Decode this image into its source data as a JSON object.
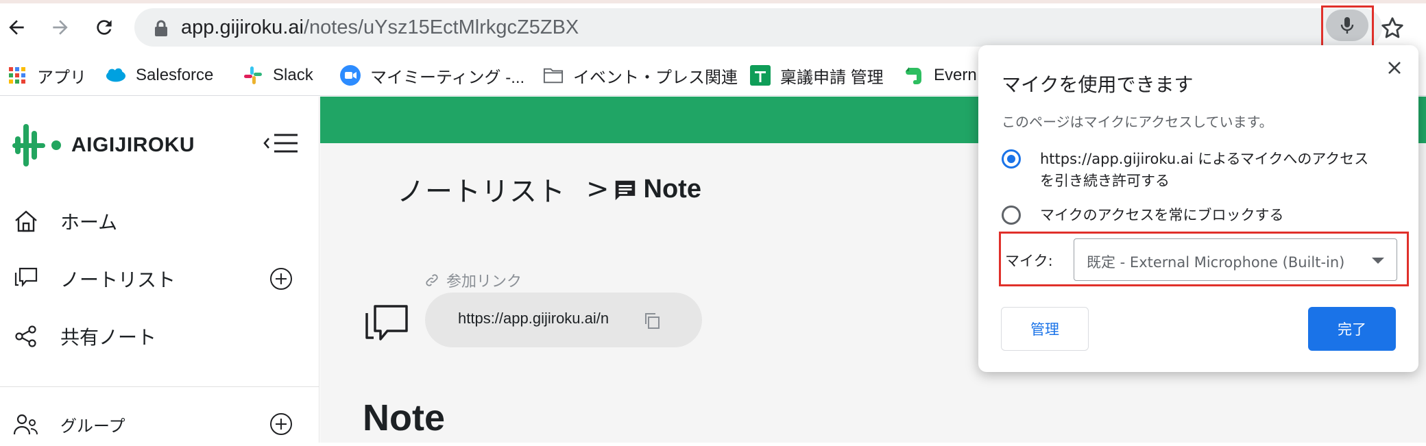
{
  "browser": {
    "url_host": "app.gijiroku.ai",
    "url_path": "/notes/uYsz15EctMlrkgcZ5ZBX"
  },
  "bookmarks": [
    {
      "label": "アプリ",
      "icon": "apps-grid-icon"
    },
    {
      "label": "Salesforce",
      "icon": "salesforce-cloud-icon"
    },
    {
      "label": "Slack",
      "icon": "slack-icon"
    },
    {
      "label": "マイミーティング -...",
      "icon": "zoom-icon"
    },
    {
      "label": "イベント・プレス関連",
      "icon": "folder-icon"
    },
    {
      "label": "稟議申請 管理",
      "icon": "sheets-icon"
    },
    {
      "label": "Evern",
      "icon": "evernote-icon"
    }
  ],
  "sidebar": {
    "brand": "AIGIJIROKU",
    "items": [
      {
        "label": "ホーム",
        "icon": "home-icon"
      },
      {
        "label": "ノートリスト",
        "icon": "notes-icon"
      },
      {
        "label": "共有ノート",
        "icon": "share-icon"
      },
      {
        "label": "グループ",
        "icon": "group-icon"
      }
    ]
  },
  "main": {
    "breadcrumb_parent": "ノートリスト",
    "breadcrumb_sep": ">",
    "breadcrumb_current": "Note",
    "join_link_label": "参加リンク",
    "join_link_url": "https://app.gijiroku.ai/n",
    "note_title": "Note"
  },
  "popup": {
    "title": "マイクを使用できます",
    "subtitle": "このページはマイクにアクセスしています。",
    "option_allow": "https://app.gijiroku.ai によるマイクへのアクセス\nを引き続き許可する",
    "option_block": "マイクのアクセスを常にブロックする",
    "mic_label": "マイク:",
    "mic_selected": "既定 - External Microphone (Built-in)",
    "manage_label": "管理",
    "done_label": "完了"
  },
  "colors": {
    "banner_green": "#20a565",
    "brand_green": "#22a55f",
    "accent_blue": "#1a73e8",
    "highlight_red": "#e0302a"
  }
}
